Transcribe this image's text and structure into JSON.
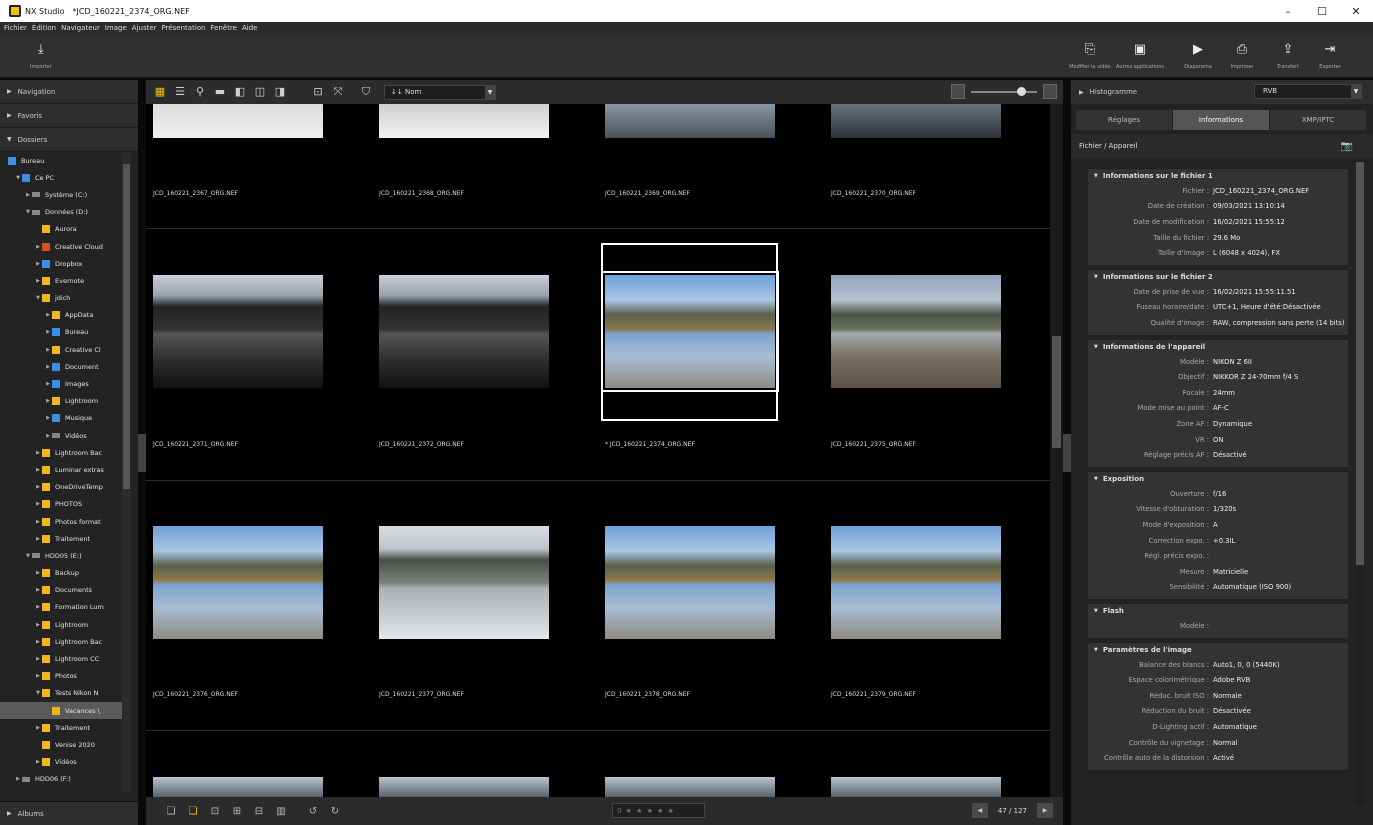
{
  "window": {
    "app_name": "NX Studio",
    "file_title": "*JCD_160221_2374_ORG.NEF",
    "controls": [
      "–",
      "☐",
      "✕"
    ]
  },
  "menu": [
    "Fichier",
    "Édition",
    "Navigateur",
    "Image",
    "Ajuster",
    "Présentation",
    "Fenêtre",
    "Aide"
  ],
  "toolbar": {
    "import_label": "Importer",
    "right_buttons": [
      {
        "icon": "video-edit-icon",
        "glyph": "⎘",
        "label": "Modifier la vidéo"
      },
      {
        "icon": "apps-icon",
        "glyph": "▣",
        "label": "Autres applications"
      },
      {
        "icon": "slideshow-icon",
        "glyph": "▶",
        "label": "Diaporama"
      },
      {
        "icon": "print-icon",
        "glyph": "⎙",
        "label": "Imprimer"
      },
      {
        "icon": "transfer-icon",
        "glyph": "⇪",
        "label": "Transfert"
      },
      {
        "icon": "export-icon",
        "glyph": "⇥",
        "label": "Exporter"
      }
    ]
  },
  "left": {
    "navigation": "Navigation",
    "favoris": "Favoris",
    "dossiers": "Dossiers",
    "albums": "Albums",
    "tree": [
      {
        "label": "Bureau",
        "indent": 0,
        "type": "blue",
        "tw": ""
      },
      {
        "label": "Ce PC",
        "indent": 1,
        "type": "blue",
        "tw": "▼"
      },
      {
        "label": "Système (C:)",
        "indent": 2,
        "type": "drive",
        "tw": "▶"
      },
      {
        "label": "Données (D:)",
        "indent": 2,
        "type": "drive",
        "tw": "▼"
      },
      {
        "label": "Aurora",
        "indent": 3,
        "type": "",
        "tw": ""
      },
      {
        "label": "Creative Cloud",
        "indent": 3,
        "type": "red",
        "tw": "▶"
      },
      {
        "label": "Dropbox",
        "indent": 3,
        "type": "blue",
        "tw": "▶"
      },
      {
        "label": "Evernote",
        "indent": 3,
        "type": "",
        "tw": "▶"
      },
      {
        "label": "jdich",
        "indent": 3,
        "type": "",
        "tw": "▼"
      },
      {
        "label": "AppData",
        "indent": 4,
        "type": "",
        "tw": "▶"
      },
      {
        "label": "Bureau",
        "indent": 4,
        "type": "blue",
        "tw": "▶"
      },
      {
        "label": "Creative Cl",
        "indent": 4,
        "type": "",
        "tw": "▶"
      },
      {
        "label": "Document",
        "indent": 4,
        "type": "blue",
        "tw": "▶"
      },
      {
        "label": "Images",
        "indent": 4,
        "type": "blue",
        "tw": "▶"
      },
      {
        "label": "Lightroom",
        "indent": 4,
        "type": "",
        "tw": "▶"
      },
      {
        "label": "Musique",
        "indent": 4,
        "type": "blue",
        "tw": "▶"
      },
      {
        "label": "Vidéos",
        "indent": 4,
        "type": "drive",
        "tw": "▶"
      },
      {
        "label": "Lightroom Bac",
        "indent": 3,
        "type": "",
        "tw": "▶"
      },
      {
        "label": "Luminar extras",
        "indent": 3,
        "type": "",
        "tw": "▶"
      },
      {
        "label": "OneDriveTemp",
        "indent": 3,
        "type": "",
        "tw": "▶"
      },
      {
        "label": "PHOTOS",
        "indent": 3,
        "type": "",
        "tw": "▶"
      },
      {
        "label": "Photos format",
        "indent": 3,
        "type": "",
        "tw": "▶"
      },
      {
        "label": "Traitement",
        "indent": 3,
        "type": "",
        "tw": "▶"
      },
      {
        "label": "HDD05 (E:)",
        "indent": 2,
        "type": "drive",
        "tw": "▼"
      },
      {
        "label": "Backup",
        "indent": 3,
        "type": "",
        "tw": "▶"
      },
      {
        "label": "Documents",
        "indent": 3,
        "type": "",
        "tw": "▶"
      },
      {
        "label": "Formation Lum",
        "indent": 3,
        "type": "",
        "tw": "▶"
      },
      {
        "label": "Lightroom",
        "indent": 3,
        "type": "",
        "tw": "▶"
      },
      {
        "label": "Lightroom Bac",
        "indent": 3,
        "type": "",
        "tw": "▶"
      },
      {
        "label": "Lightroom CC",
        "indent": 3,
        "type": "",
        "tw": "▶"
      },
      {
        "label": "Photos",
        "indent": 3,
        "type": "",
        "tw": "▶"
      },
      {
        "label": "Tests Nikon N",
        "indent": 3,
        "type": "",
        "tw": "▼"
      },
      {
        "label": "Vacances \\",
        "indent": 4,
        "type": "",
        "tw": "",
        "selected": true
      },
      {
        "label": "Traitement",
        "indent": 3,
        "type": "",
        "tw": "▶"
      },
      {
        "label": "Venise 2020",
        "indent": 3,
        "type": "",
        "tw": ""
      },
      {
        "label": "Vidéos",
        "indent": 3,
        "type": "",
        "tw": "▶"
      },
      {
        "label": "HDD06 (F:)",
        "indent": 1,
        "type": "drive",
        "tw": "▶"
      }
    ]
  },
  "browser": {
    "sort_label": "↓↓ Nom",
    "view_icons": [
      "▦",
      "☰",
      "⚲",
      "▬",
      "◧",
      "◫",
      "◨",
      "⊡",
      "⤧",
      "⛉"
    ],
    "rows": [
      {
        "names": [
          "JCD_160221_2367_ORG.NEF",
          "JCD_160221_2368_ORG.NEF",
          "JCD_160221_2369_ORG.NEF",
          "JCD_160221_2370_ORG.NEF"
        ]
      },
      {
        "names": [
          "JCD_160221_2371_ORG.NEF",
          "JCD_160221_2372_ORG.NEF",
          "* JCD_160221_2374_ORG.NEF",
          "JCD_160221_2375_ORG.NEF"
        ]
      },
      {
        "names": [
          "JCD_160221_2376_ORG.NEF",
          "JCD_160221_2377_ORG.NEF",
          "JCD_160221_2378_ORG.NEF",
          "JCD_160221_2379_ORG.NEF"
        ]
      }
    ],
    "counter": "47 / 127",
    "rating_stars": "0 ★ ★ ★ ★ ★"
  },
  "right": {
    "histogram": "Histogramme",
    "channel": "RVB",
    "tabs": [
      "Réglages",
      "Informations",
      "XMP/IPTC"
    ],
    "active_tab": 1,
    "fichier_appareil": "Fichier / Appareil",
    "sections": [
      {
        "title": "Informations sur le fichier 1",
        "rows": [
          [
            "Fichier :",
            "JCD_160221_2374_ORG.NEF"
          ],
          [
            "Date de création :",
            "09/03/2021 13:10:14"
          ],
          [
            "Date de modification :",
            "16/02/2021 15:55:12"
          ],
          [
            "Taille du fichier :",
            "29.6 Mo"
          ],
          [
            "Taille d'image :",
            "L (6048 x 4024), FX"
          ]
        ]
      },
      {
        "title": "Informations sur le fichier 2",
        "rows": [
          [
            "Date de prise de vue :",
            "16/02/2021 15:55:11.51"
          ],
          [
            "Fuseau horaire/date :",
            "UTC+1, Heure d'été:Désactivée"
          ],
          [
            "Qualité d'image :",
            "RAW, compression sans perte (14 bits)"
          ]
        ]
      },
      {
        "title": "Informations de l'appareil",
        "rows": [
          [
            "Modèle :",
            "NIKON Z 6II"
          ],
          [
            "Objectif :",
            "NIKKOR Z 24-70mm f/4 S"
          ],
          [
            "Focale :",
            "24mm"
          ],
          [
            "Mode mise au point :",
            "AF-C"
          ],
          [
            "Zone AF :",
            "Dynamique"
          ],
          [
            "VR :",
            "ON"
          ],
          [
            "Réglage précis AF :",
            "Désactivé"
          ]
        ]
      },
      {
        "title": "Exposition",
        "rows": [
          [
            "Ouverture :",
            "f/16"
          ],
          [
            "Vitesse d'obturation :",
            "1/320s"
          ],
          [
            "Mode d'exposition :",
            "A"
          ],
          [
            "Correction expo. :",
            "+0.3IL"
          ],
          [
            "Régl. précis expo. :",
            ""
          ],
          [
            "Mesure :",
            "Matricielle"
          ],
          [
            "Sensibilité :",
            "Automatique (ISO 900)"
          ]
        ]
      },
      {
        "title": "Flash",
        "rows": [
          [
            "Modèle :",
            ""
          ]
        ]
      },
      {
        "title": "Paramètres de l'image",
        "rows": [
          [
            "Balance des blancs :",
            "Auto1, 0, 0 (5440K)"
          ],
          [
            "Espace colorimétrique :",
            "Adobe RVB"
          ],
          [
            "Réduc. bruit ISO :",
            "Normale"
          ],
          [
            "Réduction du bruit :",
            "Désactivée"
          ],
          [
            "D-Lighting actif :",
            "Automatique"
          ],
          [
            "Contrôle du vignetage :",
            "Normal"
          ],
          [
            "Contrôle auto de la distorsion :",
            "Activé"
          ]
        ]
      }
    ]
  }
}
